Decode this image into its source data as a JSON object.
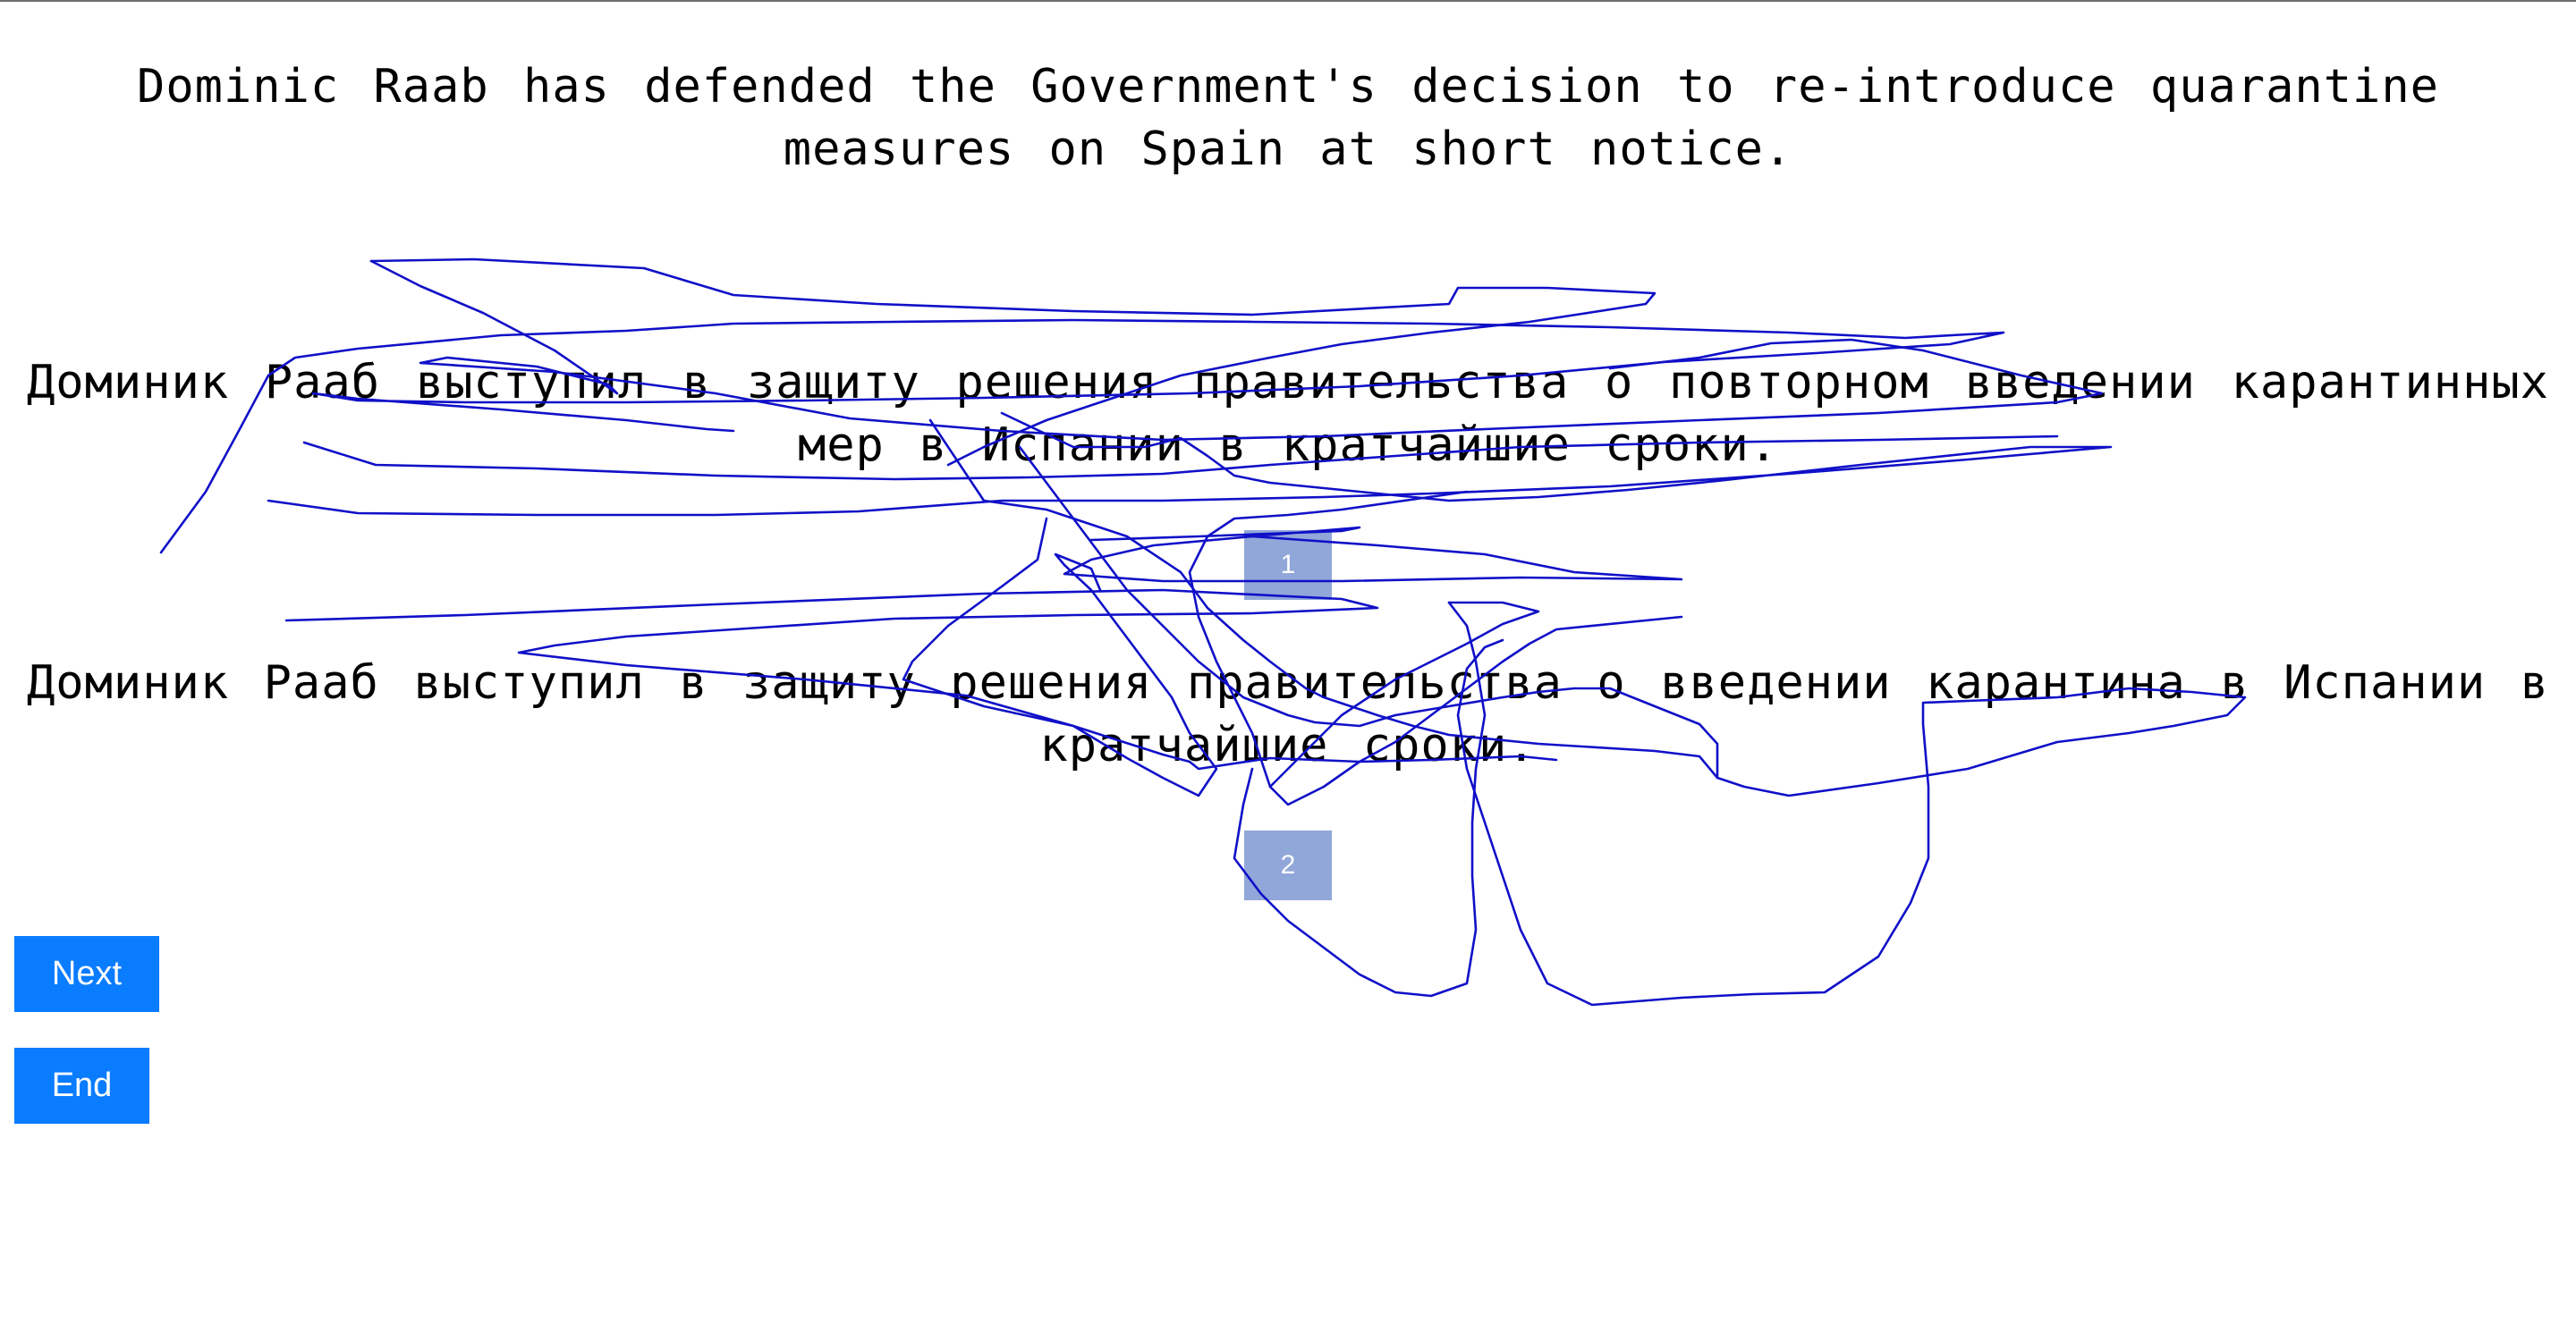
{
  "source": {
    "text": "Dominic Raab has defended the Government's decision to re-introduce quarantine measures on Spain at short notice."
  },
  "candidates": [
    {
      "text": "Доминик Рааб выступил в защиту решения правительства о повторном введении карантинных мер в Испании в кратчайшие сроки.",
      "button_label": "1"
    },
    {
      "text": "Доминик Рааб выступил в защиту решения правительства о введении карантина в Испании в кратчайшие сроки.",
      "button_label": "2"
    }
  ],
  "controls": {
    "next_label": "Next",
    "end_label": "End"
  },
  "colors": {
    "choice_button": "#91a7d9",
    "nav_button": "#0a7cff",
    "scribble": "#1010c8"
  }
}
